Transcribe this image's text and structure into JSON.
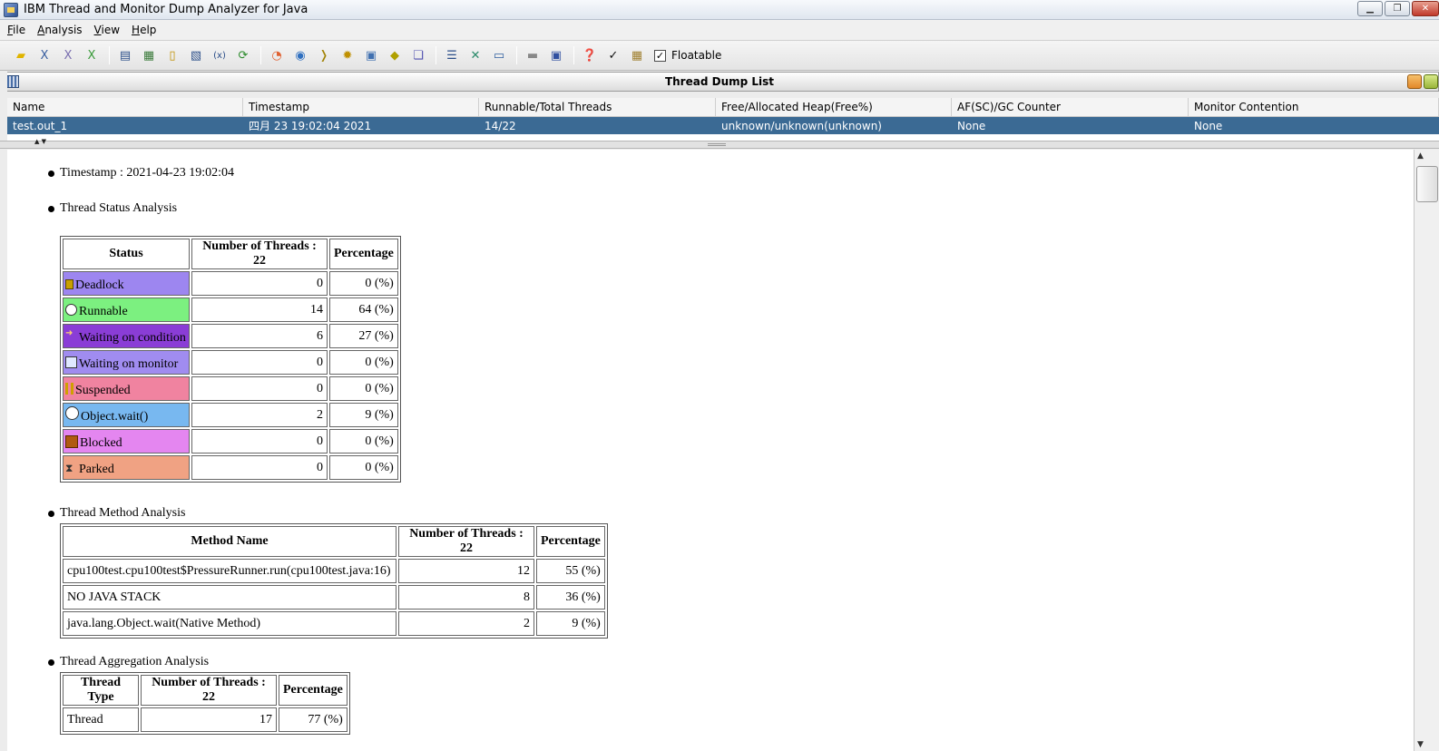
{
  "window": {
    "title": "IBM Thread and Monitor Dump Analyzer for Java"
  },
  "menu": [
    {
      "label": "File",
      "mnemonic": "F",
      "rest": "ile"
    },
    {
      "label": "Analysis",
      "mnemonic": "A",
      "rest": "nalysis"
    },
    {
      "label": "View",
      "mnemonic": "V",
      "rest": "iew"
    },
    {
      "label": "Help",
      "mnemonic": "H",
      "rest": "elp"
    }
  ],
  "toolbar": {
    "floatable_label": "Floatable",
    "floatable_checked": "✓"
  },
  "frame": {
    "title": "Thread Dump List"
  },
  "dump_list": {
    "columns": [
      "Name",
      "Timestamp",
      "Runnable/Total Threads",
      "Free/Allocated Heap(Free%)",
      "AF(SC)/GC Counter",
      "Monitor Contention"
    ],
    "row": [
      "test.out_1",
      "四月 23 19:02:04 2021",
      "14/22",
      "unknown/unknown(unknown)",
      "None",
      "None"
    ]
  },
  "report": {
    "timestamp": "Timestamp : 2021-04-23 19:02:04",
    "status_heading": "Thread Status Analysis",
    "status_table": {
      "headers": [
        "Status",
        "Number of Threads : 22",
        "Percentage"
      ],
      "rows": [
        {
          "label": "Deadlock",
          "count": "0",
          "pct": "0 (%)",
          "color": "#9d86f0",
          "icon": "lock-icon"
        },
        {
          "label": "Runnable",
          "count": "14",
          "pct": "64 (%)",
          "color": "#7cf080",
          "icon": "play-icon"
        },
        {
          "label": "Waiting on condition",
          "count": "6",
          "pct": "27 (%)",
          "color": "#8a3dd6",
          "icon": "arrow-icon"
        },
        {
          "label": "Waiting on monitor",
          "count": "0",
          "pct": "0 (%)",
          "color": "#a08cf0",
          "icon": "monitor-clock-icon"
        },
        {
          "label": "Suspended",
          "count": "0",
          "pct": "0 (%)",
          "color": "#f083a0",
          "icon": "pause-icon"
        },
        {
          "label": "Object.wait()",
          "count": "2",
          "pct": "9 (%)",
          "color": "#78b8f0",
          "icon": "clock-icon"
        },
        {
          "label": "Blocked",
          "count": "0",
          "pct": "0 (%)",
          "color": "#e486f0",
          "icon": "block-icon"
        },
        {
          "label": "Parked",
          "count": "0",
          "pct": "0 (%)",
          "color": "#f0a283",
          "icon": "hourglass-icon"
        }
      ]
    },
    "method_heading": "Thread Method Analysis",
    "method_table": {
      "headers": [
        "Method Name",
        "Number of Threads : 22",
        "Percentage"
      ],
      "rows": [
        {
          "name": "cpu100test.cpu100test$PressureRunner.run(cpu100test.java:16)",
          "count": "12",
          "pct": "55 (%)"
        },
        {
          "name": "NO JAVA STACK",
          "count": "8",
          "pct": "36 (%)"
        },
        {
          "name": "java.lang.Object.wait(Native Method)",
          "count": "2",
          "pct": "9 (%)"
        }
      ]
    },
    "aggregation_heading": "Thread Aggregation Analysis",
    "aggregation_table": {
      "headers": [
        "Thread Type",
        "Number of Threads : 22",
        "Percentage"
      ],
      "rows": [
        {
          "type": "Thread",
          "count": "17",
          "pct": "77 (%)"
        }
      ]
    }
  }
}
